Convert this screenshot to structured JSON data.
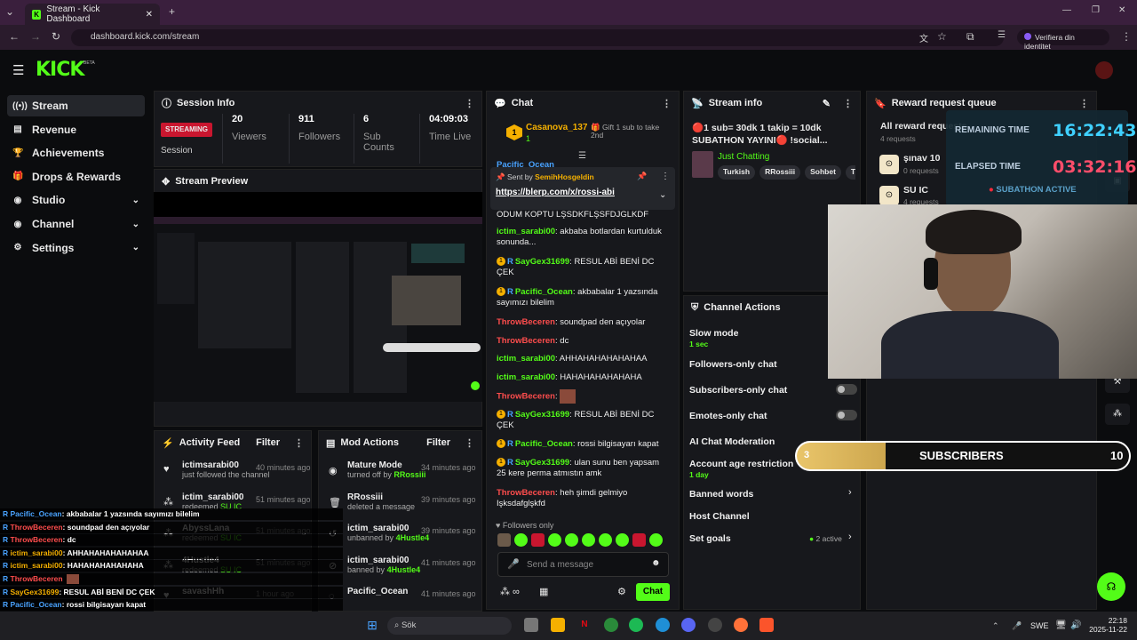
{
  "browser": {
    "tab_title": "Stream - Kick Dashboard",
    "url": "dashboard.kick.com/stream",
    "profile_label": "Verifiera din identitet"
  },
  "brand": {
    "logo": "KICK",
    "beta": "BETA",
    "accent": "#53fc18"
  },
  "sidebar": {
    "items": [
      {
        "label": "Stream",
        "icon": "stream-icon"
      },
      {
        "label": "Revenue",
        "icon": "revenue-icon"
      },
      {
        "label": "Achievements",
        "icon": "trophy-icon"
      },
      {
        "label": "Drops & Rewards",
        "icon": "gift-icon"
      },
      {
        "label": "Studio",
        "icon": "studio-icon"
      },
      {
        "label": "Channel",
        "icon": "channel-icon"
      },
      {
        "label": "Settings",
        "icon": "gear-icon"
      }
    ]
  },
  "session": {
    "title": "Session Info",
    "status": "STREAMING",
    "status_label": "Session",
    "viewers_value": "20",
    "viewers_label": "Viewers",
    "followers_value": "911",
    "followers_label": "Followers",
    "subs_value": "6",
    "subs_label": "Sub Counts",
    "time_value": "04:09:03",
    "time_label": "Time Live"
  },
  "preview": {
    "title": "Stream Preview"
  },
  "activity": {
    "title": "Activity Feed",
    "filter": "Filter",
    "items": [
      {
        "name": "ictimsarabi00",
        "desc": "just followed the channel",
        "time": "40 minutes ago"
      },
      {
        "name": "ictim_sarabi00",
        "desc": "redeemed",
        "reward": "SU IC",
        "time": "51 minutes ago"
      },
      {
        "name": "AbyssLana",
        "desc": "redeemed",
        "reward": "SU IC",
        "time": "51 minutes ago"
      },
      {
        "name": "4Hustle4",
        "desc": "redeemed",
        "reward": "SU IC",
        "time": "51 minutes ago"
      },
      {
        "name": "savashHh",
        "desc": "",
        "time": "1 hour ago"
      }
    ]
  },
  "mod": {
    "title": "Mod Actions",
    "filter": "Filter",
    "items": [
      {
        "name": "Mature Mode",
        "desc": "turned off by",
        "by": "RRossiii",
        "time": "34 minutes ago"
      },
      {
        "name": "RRossiii",
        "desc": "deleted a message",
        "by": "",
        "time": "39 minutes ago"
      },
      {
        "name": "ictim_sarabi00",
        "desc": "unbanned by",
        "by": "4Hustle4",
        "time": "39 minutes ago"
      },
      {
        "name": "ictim_sarabi00",
        "desc": "banned by",
        "by": "4Hustle4",
        "time": "41 minutes ago"
      },
      {
        "name": "Pacific_Ocean",
        "desc": "",
        "by": "",
        "time": "41 minutes ago"
      }
    ]
  },
  "chat": {
    "title": "Chat",
    "gift_user": "Casanova_137",
    "gift_count": "1",
    "gift_text": "Gift 1 sub to take 2nd",
    "pinned_by_label": "Sent by",
    "pinned_by": "SemihHosgeldin",
    "pinned_link": "https://blerp.com/x/rossi-abi",
    "partial_user": "Pacific_Ocean",
    "messages": [
      {
        "user": "",
        "text": "ODUM KOPTU LŞSDKFLŞSFDJGLKDF",
        "color": "#eee"
      },
      {
        "user": "ictim_sarabi00",
        "text": "akbaba botlardan kurtulduk sonunda...",
        "color": "#53fc18"
      },
      {
        "user": "SayGex31699",
        "text": "RESUL ABİ BENİ DC ÇEK",
        "color": "#53fc18"
      },
      {
        "user": "Pacific_Ocean",
        "text": "akbabalar 1 yazsında sayımızı bilelim",
        "color": "#53fc18"
      },
      {
        "user": "ThrowBeceren",
        "text": "soundpad den açıyolar",
        "color": "#ff4d4d"
      },
      {
        "user": "ThrowBeceren",
        "text": "dc",
        "color": "#ff4d4d"
      },
      {
        "user": "ictim_sarabi00",
        "text": "AHHAHAHAHAHAHAA",
        "color": "#53fc18"
      },
      {
        "user": "ictim_sarabi00",
        "text": "HAHAHAHAHAHAHA",
        "color": "#53fc18"
      },
      {
        "user": "ThrowBeceren",
        "text": "",
        "color": "#ff4d4d"
      },
      {
        "user": "SayGex31699",
        "text": "RESUL ABİ BENİ DC ÇEK",
        "color": "#53fc18"
      },
      {
        "user": "Pacific_Ocean",
        "text": "rossi bilgisayarı kapat",
        "color": "#53fc18"
      },
      {
        "user": "SayGex31699",
        "text": "ulan sunu ben yapsam 25 kere perma atmıstın amk",
        "color": "#53fc18"
      },
      {
        "user": "ThrowBeceren",
        "text": "heh şimdi gelmiyo Işksdafglşkfd",
        "color": "#ff4d4d"
      }
    ],
    "followers_only": "Followers only",
    "placeholder": "Send a message",
    "send": "Chat"
  },
  "streaminfo": {
    "title": "Stream info",
    "stream_title": "🔴1 sub= 30dk 1 takip = 10dk SUBATHON YAYINI🔴 !social...",
    "category": "Just Chatting",
    "tags": [
      "Turkish",
      "RRossiii",
      "Sohbet",
      "Türk"
    ]
  },
  "actions": {
    "title": "Channel Actions",
    "slow_mode": "Slow mode",
    "slow_value": "1 sec",
    "followers_only": "Followers-only chat",
    "subs_only": "Subscribers-only chat",
    "emotes_only": "Emotes-only chat",
    "ai_mod": "AI Chat Moderation",
    "age": "Account age restriction",
    "age_value": "1 day",
    "banned": "Banned words",
    "host": "Host Channel",
    "goals": "Set goals",
    "goals_value": "2 active"
  },
  "rewards": {
    "title": "Reward request queue",
    "all": "All reward requests",
    "all_count": "4 requests",
    "items": [
      {
        "name": "şınav 10",
        "count": "0 requests"
      },
      {
        "name": "SU IC",
        "count": "4 requests"
      }
    ]
  },
  "subathon": {
    "remaining_label": "REMAINING TIME",
    "remaining": "16:22:43",
    "elapsed_label": "ELAPSED TIME",
    "elapsed": "03:32:16",
    "status": "SUBATHON ACTIVE"
  },
  "subsbar": {
    "label": "SUBSCRIBERS",
    "current": "3",
    "goal": "10",
    "progress": 0.3
  },
  "overlay_chat": [
    {
      "user": "Pacific_Ocean",
      "text": ": akbabalar 1 yazsında sayımızı bilelim",
      "color": "#4aa3ff"
    },
    {
      "user": "ThrowBeceren",
      "text": ": soundpad den açıyolar",
      "color": "#ff4d4d"
    },
    {
      "user": "ThrowBeceren",
      "text": ": dc",
      "color": "#ff4d4d"
    },
    {
      "user": "ictim_sarabi00",
      "text": ": AHHAHAHAHAHAHAA",
      "color": "#f5b000"
    },
    {
      "user": "ictim_sarabi00",
      "text": ": HAHAHAHAHAHAHA",
      "color": "#f5b000"
    },
    {
      "user": "ThrowBeceren",
      "text": "",
      "color": "#ff4d4d"
    },
    {
      "user": "SayGex31699",
      "text": ": RESUL ABİ BENİ DC ÇEK",
      "color": "#f5b000"
    },
    {
      "user": "Pacific_Ocean",
      "text": ": rossi bilgisayarı kapat",
      "color": "#4aa3ff"
    },
    {
      "user": "SayGex31699",
      "text": ": ulan sunu ben yapsam 25 kere perma atmıstın amk",
      "color": "#f5b000"
    },
    {
      "user": "ThrowBeceren",
      "text": ": heh şimdi gelmiyo Işksdafglşkfd",
      "color": "#ff4d4d"
    }
  ],
  "taskbar": {
    "search": "Sök",
    "lang": "SWE",
    "time": "22:18",
    "date": "2025-11-22"
  }
}
